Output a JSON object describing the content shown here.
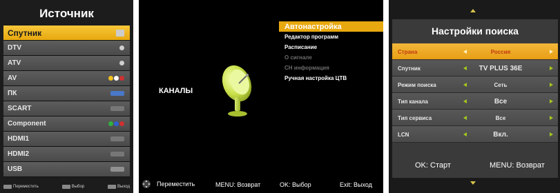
{
  "source_panel": {
    "title": "Источник",
    "items": [
      {
        "label": "Спутник",
        "selected": true,
        "icon": "satellite-dish-icon"
      },
      {
        "label": "DTV",
        "selected": false,
        "icon": "antenna-icon"
      },
      {
        "label": "ATV",
        "selected": false,
        "icon": "antenna-icon"
      },
      {
        "label": "AV",
        "selected": false,
        "icon": "rca-connector-icon"
      },
      {
        "label": "ПК",
        "selected": false,
        "icon": "vga-connector-icon"
      },
      {
        "label": "SCART",
        "selected": false,
        "icon": "scart-connector-icon"
      },
      {
        "label": "Component",
        "selected": false,
        "icon": "component-connector-icon"
      },
      {
        "label": "HDMI1",
        "selected": false,
        "icon": "hdmi-connector-icon"
      },
      {
        "label": "HDMI2",
        "selected": false,
        "icon": "hdmi-connector-icon"
      },
      {
        "label": "USB",
        "selected": false,
        "icon": "usb-connector-icon"
      }
    ],
    "footer": {
      "move": "Переместить",
      "select": "Выбор",
      "exit": "Выход"
    },
    "colors": {
      "selected": "#f0b624",
      "row": "#555555"
    }
  },
  "channels_panel": {
    "category": "КАНАЛЫ",
    "menu": [
      {
        "label": "Автонастройка",
        "state": "selected"
      },
      {
        "label": "Редактор программ",
        "state": "normal"
      },
      {
        "label": "Расписание",
        "state": "normal"
      },
      {
        "label": "О сигнале",
        "state": "disabled"
      },
      {
        "label": "CH информация",
        "state": "disabled"
      },
      {
        "label": "Ручная настройка ЦТВ",
        "state": "normal"
      }
    ],
    "footer": {
      "move": "Переместить",
      "back": "MENU: Возврат",
      "ok": "OK: Выбор",
      "exit": "Exit: Выход"
    },
    "colors": {
      "selected": "#e8a80f",
      "disabled": "#6b6b6b"
    }
  },
  "search_panel": {
    "title": "Настройки поиска",
    "rows": [
      {
        "label": "Страна",
        "value": "Россия",
        "selected": true
      },
      {
        "label": "Спутник",
        "value": "TV PLUS 36E",
        "selected": false
      },
      {
        "label": "Режим поиска",
        "value": "Сеть",
        "selected": false
      },
      {
        "label": "Тип канала",
        "value": "Все",
        "selected": false
      },
      {
        "label": "Тип сервиса",
        "value": "Все",
        "selected": false
      },
      {
        "label": "LCN",
        "value": "Вкл.",
        "selected": false
      }
    ],
    "footer": {
      "ok": "OK: Старт",
      "back": "MENU: Возврат"
    },
    "colors": {
      "selected": "#f0a825",
      "arrow": "#a6c81e"
    }
  }
}
